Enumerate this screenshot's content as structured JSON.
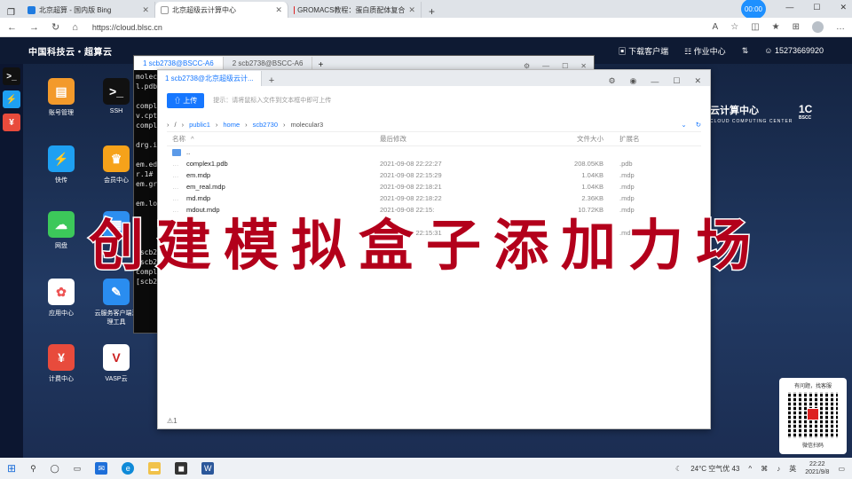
{
  "browser": {
    "tabs": [
      {
        "label": "北京超算 - 国内版 Bing",
        "active": false
      },
      {
        "label": "北京超级云计算中心",
        "active": true
      },
      {
        "label": "GROMACS教程：蛋白质配体复合",
        "active": false
      }
    ],
    "clock_badge": "00:00",
    "url": "https://cloud.blsc.cn"
  },
  "site": {
    "brand": "中国科技云・超算云",
    "topbar": {
      "download": "下载客户端",
      "jobs": "作业中心",
      "phone": "15273669920"
    },
    "brand_right": "云计算中心",
    "brand_right_sub": "CLOUD COMPUTING CENTER",
    "bscc": "1C",
    "bscc_sub": "BSCC"
  },
  "desktop_icons": [
    {
      "label": "账号管理",
      "color": "#f39a2b",
      "glyph": "▤"
    },
    {
      "label": "SSH",
      "color": "#111111",
      "glyph": ">_"
    },
    {
      "label": "快传",
      "color": "#1ea0f2",
      "glyph": "⚡"
    },
    {
      "label": "会员中心",
      "color": "#f6a21a",
      "glyph": "♛"
    },
    {
      "label": "网盘",
      "color": "#3cc85a",
      "glyph": "☁"
    },
    {
      "label": "",
      "color": "#2d8ef0",
      "glyph": "▦"
    },
    {
      "label": "应用中心",
      "color": "#ffffff",
      "glyph": "✿"
    },
    {
      "label": "云服务客户端清理工具",
      "color": "#2a8df0",
      "glyph": "✎"
    },
    {
      "label": "计费中心",
      "color": "#e84b3c",
      "glyph": "¥"
    },
    {
      "label": "VASP云",
      "color": "#ffffff",
      "glyph": "V"
    }
  ],
  "terminal": {
    "tabs": [
      "1 scb2738@BSCC-A6",
      "2 scb2738@BSCC-A6"
    ],
    "lines": [
      "molec",
      "l.pdb",
      "",
      "compl",
      "v.cpt",
      "compl",
      "",
      "drg.i",
      "",
      "em.ed",
      "r.1#",
      "em.gr",
      "",
      "em.lo",
      "",
      "",
      "",
      "",
      "[scb2",
      "[scb2",
      "compl",
      "[scb2"
    ]
  },
  "file_manager": {
    "tab": "1 scb2738@北京超级云计...",
    "upload": "上传",
    "hint": "提示：请将鼠标入文件到文本框中即可上传",
    "path": [
      "/",
      "public1",
      "home",
      "scb2730",
      "molecular3"
    ],
    "columns": {
      "name": "名称",
      "date": "最后修改",
      "size": "文件大小",
      "type": "扩展名"
    },
    "files": [
      {
        "name": "..",
        "date": "",
        "size": "",
        "type": "",
        "folder": true
      },
      {
        "name": "complex1.pdb",
        "date": "2021-09-08 22:22:27",
        "size": "208.05KB",
        "type": ".pdb"
      },
      {
        "name": "em.mdp",
        "date": "2021-09-08 22:15:29",
        "size": "1.04KB",
        "type": ".mdp"
      },
      {
        "name": "em_real.mdp",
        "date": "2021-09-08 22:18:21",
        "size": "1.04KB",
        "type": ".mdp"
      },
      {
        "name": "md.mdp",
        "date": "2021-09-08 22:18:22",
        "size": "2.36KB",
        "type": ".mdp"
      },
      {
        "name": "mdout.mdp",
        "date": "2021-09-08 22:15:",
        "size": "10.72KB",
        "type": ".mdp"
      },
      {
        "name": "",
        "date": "",
        "size": "",
        "type": ""
      },
      {
        "name": "",
        "date": "2021-09-08 22:15:31",
        "size": "",
        "type": ".mdp"
      }
    ],
    "status": "⚠1"
  },
  "overlay_title": "创建模拟盒子添加力场",
  "qr": {
    "top": "有问题，找客服",
    "bottom": "微信扫码"
  },
  "taskbar": {
    "weather": "24°C 空气优 43",
    "ime": "英",
    "time": "22:22",
    "date": "2021/9/8"
  }
}
